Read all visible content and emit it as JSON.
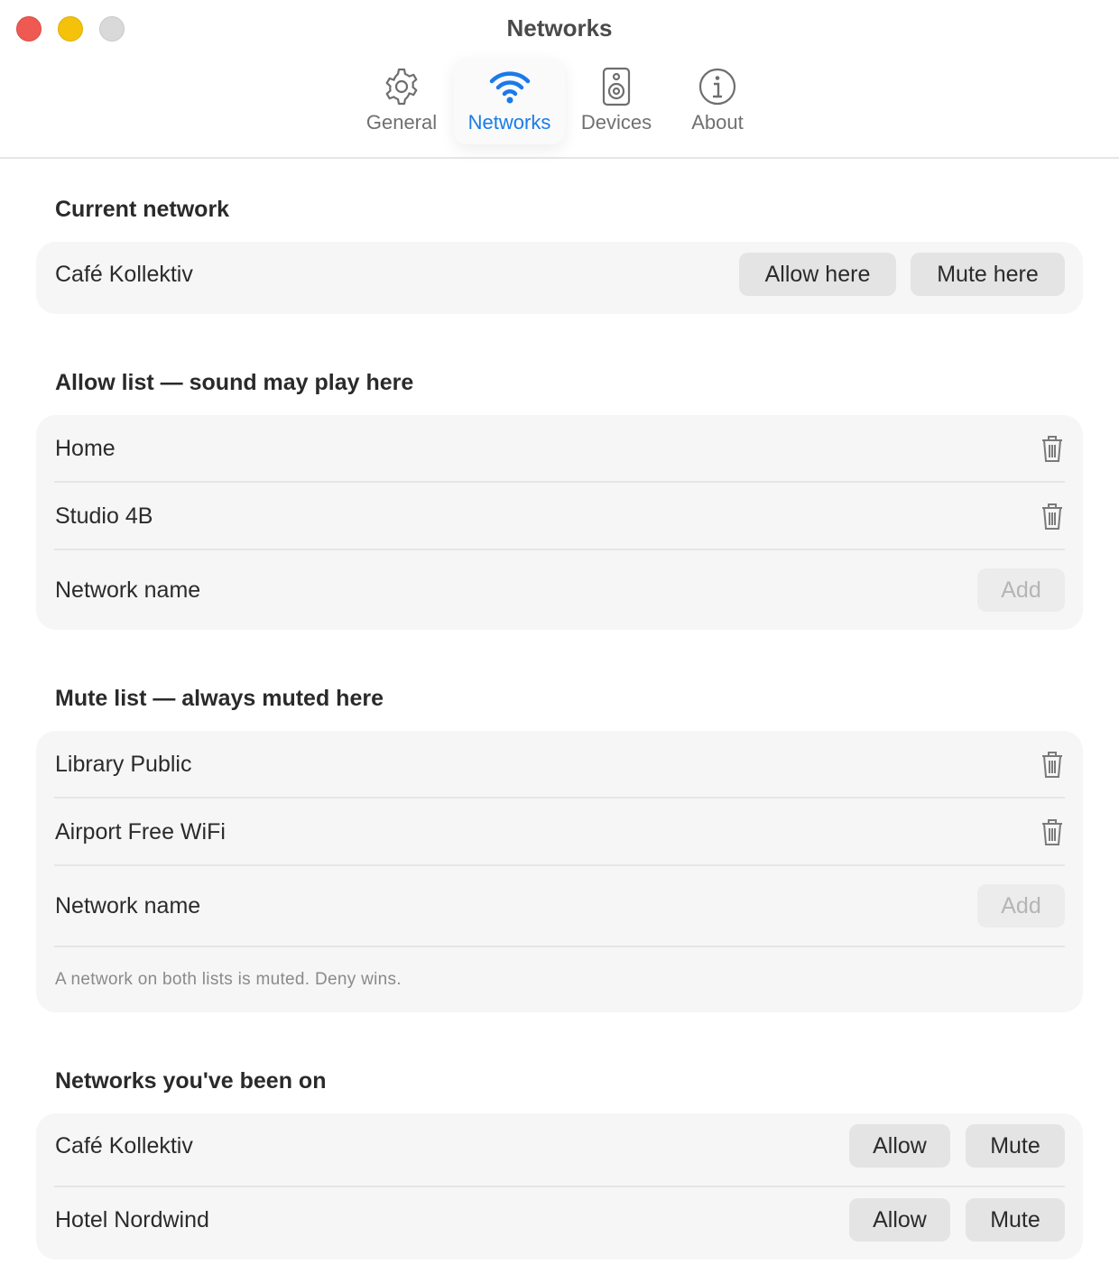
{
  "window": {
    "title": "Networks"
  },
  "tabs": [
    {
      "label": "General",
      "icon": "gear-icon"
    },
    {
      "label": "Networks",
      "icon": "wifi-icon",
      "active": true
    },
    {
      "label": "Devices",
      "icon": "speaker-icon"
    },
    {
      "label": "About",
      "icon": "info-icon"
    }
  ],
  "colors": {
    "accent": "#1a7be8",
    "close": "#ee5a52",
    "minimize": "#f5c20b",
    "zoom": "#d9d9d9"
  },
  "current": {
    "title": "Current network",
    "network": "Café Kollektiv",
    "allow_label": "Allow here",
    "mute_label": "Mute here"
  },
  "allow_list": {
    "title": "Allow list — sound may play here",
    "items": [
      "Home",
      "Studio 4B"
    ],
    "input_placeholder": "Network name",
    "add_label": "Add"
  },
  "mute_list": {
    "title": "Mute list — always muted here",
    "items": [
      "Library Public",
      "Airport Free WiFi"
    ],
    "input_placeholder": "Network name",
    "add_label": "Add",
    "note": "A network on both lists is muted. Deny wins."
  },
  "history": {
    "title": "Networks you've been on",
    "items": [
      {
        "name": "Café Kollektiv",
        "allow_label": "Allow",
        "mute_label": "Mute"
      },
      {
        "name": "Hotel Nordwind",
        "allow_label": "Allow",
        "mute_label": "Mute"
      }
    ]
  }
}
